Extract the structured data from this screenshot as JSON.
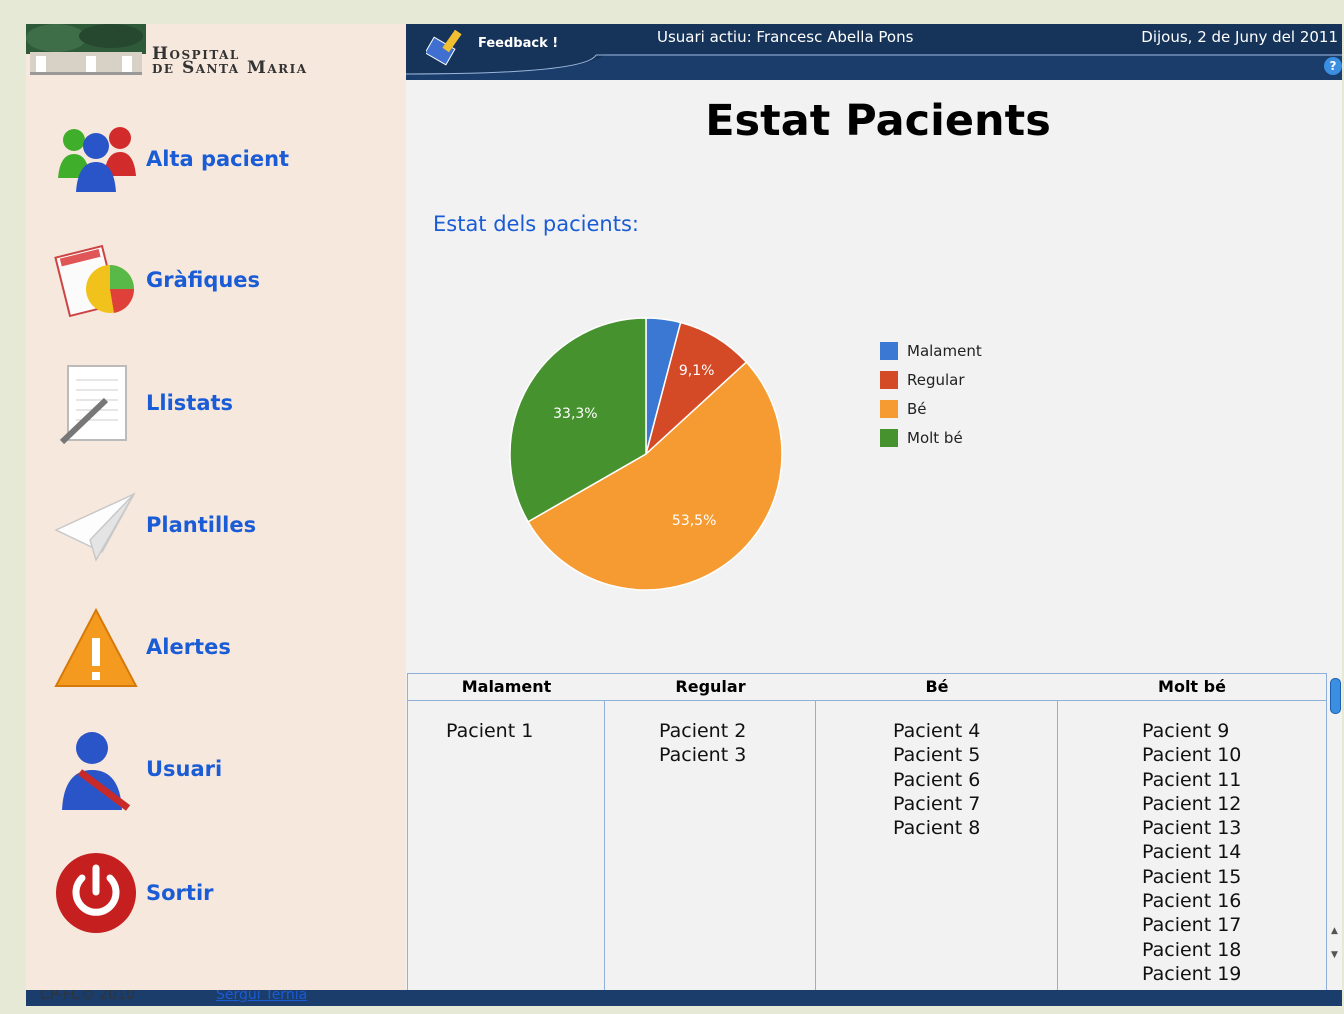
{
  "hospital": {
    "line1": "Hospital",
    "line2": "de Santa Maria"
  },
  "header": {
    "feedback": "Feedback !",
    "active_user": "Usuari actiu: Francesc Abella Pons",
    "date": "Dijous, 2 de Juny del 2011",
    "help_icon": "question-icon"
  },
  "sidebar": {
    "items": [
      {
        "label": "Alta pacient",
        "icon": "users-icon"
      },
      {
        "label": "Gràfiques",
        "icon": "pie-chart-icon"
      },
      {
        "label": "Llistats",
        "icon": "notepad-icon"
      },
      {
        "label": "Plantilles",
        "icon": "paper-plane-icon"
      },
      {
        "label": "Alertes",
        "icon": "warning-icon"
      },
      {
        "label": "Usuari",
        "icon": "user-icon"
      },
      {
        "label": "Sortir",
        "icon": "power-icon"
      }
    ]
  },
  "main": {
    "title": "Estat Pacients",
    "chart_heading": "Estat dels pacients:"
  },
  "chart_data": {
    "type": "pie",
    "categories": [
      "Malament",
      "Regular",
      "Bé",
      "Molt bé"
    ],
    "values": [
      4.1,
      9.1,
      53.5,
      33.3
    ],
    "labels": [
      "",
      "9,1%",
      "53,5%",
      "33,3%"
    ],
    "colors": [
      "#3b78d4",
      "#d54a26",
      "#f59b31",
      "#46922e"
    ],
    "legend": "right"
  },
  "table": {
    "headers": [
      "Malament",
      "Regular",
      "Bé",
      "Molt bé"
    ],
    "columns": [
      [
        "Pacient 1"
      ],
      [
        "Pacient 2",
        "Pacient 3"
      ],
      [
        "Pacient 4",
        "Pacient 5",
        "Pacient 6",
        "Pacient 7",
        "Pacient 8"
      ],
      [
        "Pacient 9",
        "Pacient 10",
        "Pacient 11",
        "Pacient 12",
        "Pacient 13",
        "Pacient 14",
        "Pacient 15",
        "Pacient 16",
        "Pacient 17",
        "Pacient 18",
        "Pacient 19"
      ]
    ]
  },
  "footer": {
    "copyright": "CP-FC© 2010 ·",
    "link": "Sergui Tèrnia"
  }
}
